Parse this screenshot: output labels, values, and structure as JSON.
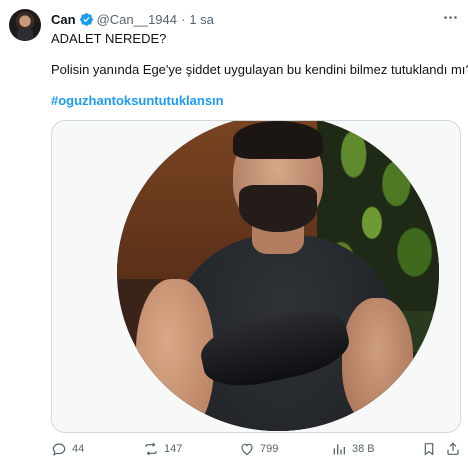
{
  "tweet": {
    "author": {
      "name": "Can",
      "handle": "@Can__1944",
      "separator": "·",
      "time": "1 sa"
    },
    "lines": [
      "ADALET NEREDE?",
      "Polisin yanında Ege'ye şiddet uygulayan bu kendini bilmez tutuklandı mı?"
    ],
    "hashtag": "#oguzhantoksuntutuklansın",
    "media": {
      "description": "photo"
    }
  },
  "actions": {
    "replies": "44",
    "reposts": "147",
    "likes": "799",
    "views": "38 B"
  },
  "colors": {
    "accent": "#1d9bf0",
    "text": "#0f1419",
    "muted": "#536471",
    "border": "#cfd9de"
  },
  "icons": {
    "verified": "verified-badge-icon",
    "more": "more-icon",
    "reply": "reply-icon",
    "repost": "repost-icon",
    "like": "heart-icon",
    "views": "views-chart-icon",
    "bookmark": "bookmark-icon",
    "share": "share-icon"
  }
}
